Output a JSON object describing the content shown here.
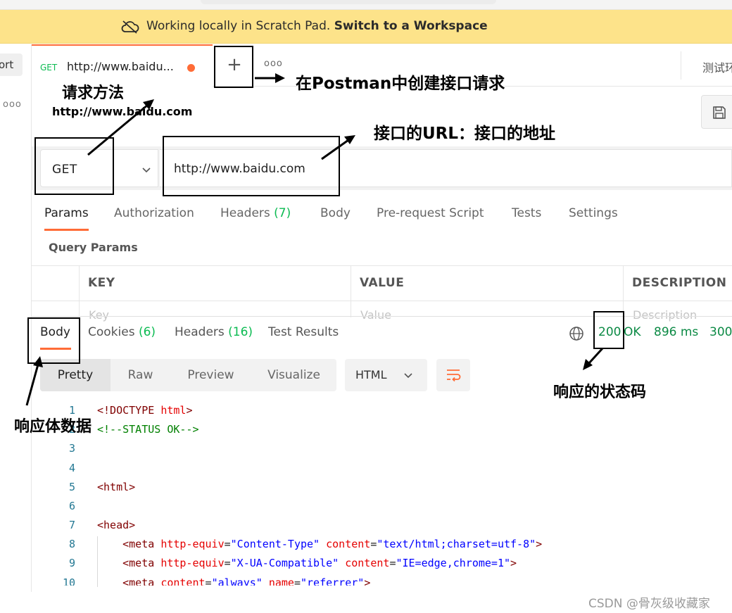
{
  "banner": {
    "message": "Working locally in Scratch Pad.",
    "link": "Switch to a Workspace",
    "icon": "cloud-off-icon"
  },
  "sidebar": {
    "import_label": "ort",
    "more_icon": "more-dots-icon"
  },
  "tabs": {
    "active": {
      "method": "GET",
      "title": "http://www.baidu...",
      "unsaved": true
    },
    "new_tab_icon": "plus-icon",
    "more_icon": "more-dots-icon",
    "environment": "测试环"
  },
  "request": {
    "method": "GET",
    "url": "http://www.baidu.com"
  },
  "request_tabs": {
    "params": "Params",
    "authorization": "Authorization",
    "headers": "Headers",
    "headers_count": "(7)",
    "body": "Body",
    "pre_request": "Pre-request Script",
    "tests": "Tests",
    "settings": "Settings"
  },
  "query_params": {
    "title": "Query Params",
    "columns": [
      "KEY",
      "VALUE",
      "DESCRIPTION"
    ],
    "placeholders": [
      "Key",
      "Value",
      "Description"
    ]
  },
  "response": {
    "tabs": {
      "body": "Body",
      "cookies": "Cookies",
      "cookies_count": "(6)",
      "headers": "Headers",
      "headers_count": "(16)",
      "test_results": "Test Results"
    },
    "status_code": "200",
    "status_text": "OK",
    "time": "896 ms",
    "size": "300",
    "views": [
      "Pretty",
      "Raw",
      "Preview",
      "Visualize"
    ],
    "format": "HTML"
  },
  "code_lines": [
    "1",
    "2",
    "3",
    "4",
    "5",
    "6",
    "7",
    "8",
    "9",
    "10"
  ],
  "annotations": {
    "new_request": "在Postman中创建接口请求",
    "method_label": "请求方法",
    "method_example": "http://www.baidu.com",
    "url_label": "接口的URL：接口的地址",
    "body_label": "响应体数据",
    "status_label": "响应的状态码"
  },
  "watermark": "CSDN @骨灰级收藏家",
  "colors": {
    "accent": "#ff6c37",
    "success": "#0cbb52",
    "banner_bg": "#fde38a"
  }
}
